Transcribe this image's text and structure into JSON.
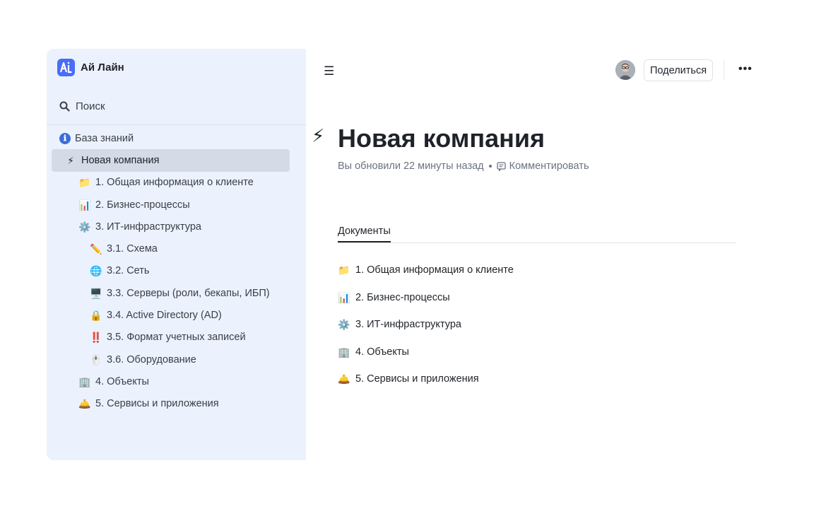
{
  "brand": {
    "name": "Ай Лайн",
    "logo_icon": "ai-line-logo-icon",
    "logo_color": "#4a6cf7"
  },
  "sidebar": {
    "search_label": "Поиск",
    "items": [
      {
        "icon": "ℹ",
        "label": "База знаний",
        "level": 0
      },
      {
        "icon": "⚡",
        "label": "Новая компания",
        "level": 1,
        "active": true
      },
      {
        "icon": "📁",
        "label": "1. Общая информация о клиенте",
        "level": 2
      },
      {
        "icon": "📊",
        "label": "2. Бизнес-процессы",
        "level": 2
      },
      {
        "icon": "⚙️",
        "label": "3. ИТ-инфраструктура",
        "level": 2
      },
      {
        "icon": "✏️",
        "label": "3.1. Схема",
        "level": 3
      },
      {
        "icon": "🌐",
        "label": "3.2. Сеть",
        "level": 3
      },
      {
        "icon": "🖥️",
        "label": "3.3. Серверы (роли, бекапы, ИБП)",
        "level": 3
      },
      {
        "icon": "🔒",
        "label": "3.4. Active Directory (AD)",
        "level": 3
      },
      {
        "icon": "‼️",
        "label": "3.5. Формат учетных записей",
        "level": 3
      },
      {
        "icon": "🖱️",
        "label": "3.6. Оборудование",
        "level": 3
      },
      {
        "icon": "🏢",
        "label": "4. Объекты",
        "level": 2
      },
      {
        "icon": "🛎️",
        "label": "5. Сервисы и приложения",
        "level": 2
      }
    ]
  },
  "header": {
    "menu_icon": "☰",
    "share_label": "Поделиться",
    "more_icon": "•••"
  },
  "page": {
    "title_icon": "⚡",
    "title": "Новая компания",
    "updated_text": "Вы обновили 22 минуты назад",
    "comment_label": "Комментировать",
    "tab_label": "Документы",
    "documents": [
      {
        "icon": "📁",
        "label": "1. Общая информация о клиенте"
      },
      {
        "icon": "📊",
        "label": "2. Бизнес-процессы"
      },
      {
        "icon": "⚙️",
        "label": "3. ИТ-инфраструктура"
      },
      {
        "icon": "🏢",
        "label": "4. Объекты"
      },
      {
        "icon": "🛎️",
        "label": "5. Сервисы и приложения"
      }
    ]
  },
  "colors": {
    "sidebar_bg": "#ebf2fd",
    "active_item_bg": "#d3dbe6",
    "accent": "#4a6cf7"
  }
}
